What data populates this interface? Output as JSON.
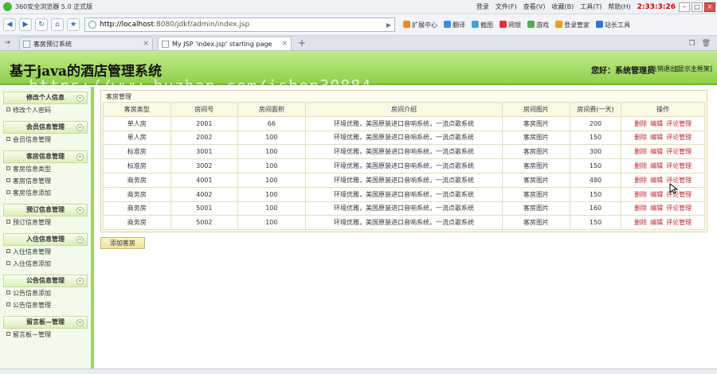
{
  "browser": {
    "app_title": "360安全浏览器 5.0 正式版",
    "menu": [
      "登录",
      "文件(F)",
      "查看(V)",
      "收藏(B)",
      "工具(T)",
      "帮助(H)"
    ],
    "clock": "2:33:3:26",
    "url_host": "http://localhost",
    "url_path": ":8080/jdkf/admin/index.jsp",
    "tools": [
      "扩展中心",
      "翻译",
      "截图",
      "网银",
      "游戏",
      "登录管家",
      "站长工具"
    ],
    "tabs": [
      {
        "label": "客房预订系统",
        "active": false
      },
      {
        "label": "My JSP 'index.jsp' starting page",
        "active": true
      }
    ]
  },
  "site": {
    "title": "基于java的酒店管理系统",
    "welcome": "您好：系统管理员",
    "logout": "[注销退出]",
    "home": "[显示主框架]",
    "watermark": "https://www.huzhan.com/ishop30884"
  },
  "menu_groups": [
    {
      "title": "修改个人信息",
      "items": [
        "修改个人密码"
      ]
    },
    {
      "title": "会员信息管理",
      "items": [
        "会员信息管理"
      ]
    },
    {
      "title": "客房信息管理",
      "items": [
        "客房信息类型",
        "客房信息管理",
        "客房信息添加"
      ]
    },
    {
      "title": "预订信息管理",
      "items": [
        "预订信息管理"
      ]
    },
    {
      "title": "入住信息管理",
      "items": [
        "入住信息管理",
        "入住信息添加"
      ]
    },
    {
      "title": "公告信息管理",
      "items": [
        "公告信息添加",
        "公告信息管理"
      ]
    },
    {
      "title": "留言板—管理",
      "items": [
        "留言板—管理"
      ]
    }
  ],
  "panel_title": "客房管理",
  "table": {
    "headers": [
      "客房类型",
      "房间号",
      "房间面积",
      "房间介绍",
      "房间图片",
      "房间费(一天)",
      "操作"
    ],
    "rows": [
      {
        "type": "单人房",
        "number": "2001",
        "area": "66",
        "intro": "环境优雅，美国原装进口音响系统，一流点歌系统",
        "image": "客房图片",
        "price": "200"
      },
      {
        "type": "单人房",
        "number": "2002",
        "area": "100",
        "intro": "环境优雅，美国原装进口音响系统，一流点歌系统",
        "image": "客房图片",
        "price": "150"
      },
      {
        "type": "标准房",
        "number": "3001",
        "area": "100",
        "intro": "环境优雅，美国原装进口音响系统，一流点歌系统",
        "image": "客房图片",
        "price": "300"
      },
      {
        "type": "标准房",
        "number": "3002",
        "area": "100",
        "intro": "环境优雅，美国原装进口音响系统，一流点歌系统",
        "image": "客房图片",
        "price": "150"
      },
      {
        "type": "商务房",
        "number": "4001",
        "area": "100",
        "intro": "环境优雅，美国原装进口音响系统，一流点歌系统",
        "image": "客房图片",
        "price": "480"
      },
      {
        "type": "商务房",
        "number": "4002",
        "area": "100",
        "intro": "环境优雅，美国原装进口音响系统，一流点歌系统",
        "image": "客房图片",
        "price": "150"
      },
      {
        "type": "商务房",
        "number": "5001",
        "area": "100",
        "intro": "环境优雅，美国原装进口音响系统，一流点歌系统",
        "image": "客房图片",
        "price": "160"
      },
      {
        "type": "商务房",
        "number": "5002",
        "area": "100",
        "intro": "环境优雅，美国原装进口音响系统，一流点歌系统",
        "image": "客房图片",
        "price": "150"
      }
    ],
    "actions": [
      "删除",
      "编辑",
      "评论管理"
    ]
  },
  "add_button": "添加客房",
  "colors": {
    "header_green": "#8fd04b",
    "action_red": "#c0272d",
    "clock_red": "#cc0000"
  }
}
